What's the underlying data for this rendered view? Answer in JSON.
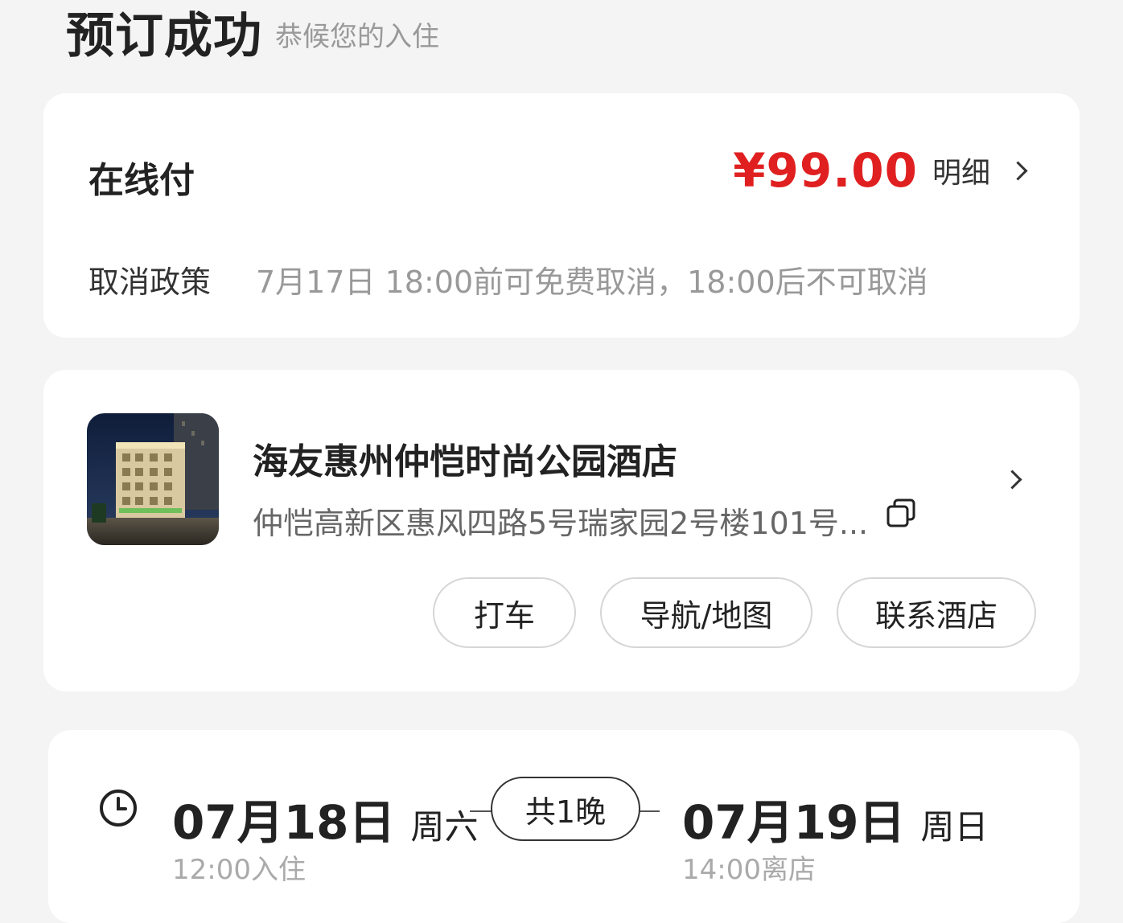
{
  "header": {
    "title": "预订成功",
    "subtitle": "恭候您的入住"
  },
  "payment": {
    "label": "在线付",
    "amount": "¥99.00",
    "detail_label": "明细",
    "policy_label": "取消政策",
    "policy_text": "7月17日 18:00前可免费取消，18:00后不可取消"
  },
  "hotel": {
    "name": "海友惠州仲恺时尚公园酒店",
    "address": "仲恺高新区惠风四路5号瑞家园2号楼101号...",
    "buttons": {
      "taxi": "打车",
      "navigation": "导航/地图",
      "contact": "联系酒店"
    }
  },
  "stay": {
    "checkin_date": "07月18日",
    "checkin_weekday": "周六",
    "checkin_time": "12:00入住",
    "nights": "共1晚",
    "checkout_date": "07月19日",
    "checkout_weekday": "周日",
    "checkout_time": "14:00离店"
  },
  "colors": {
    "price": "#e02020",
    "background": "#f4f4f4",
    "card": "#ffffff"
  }
}
